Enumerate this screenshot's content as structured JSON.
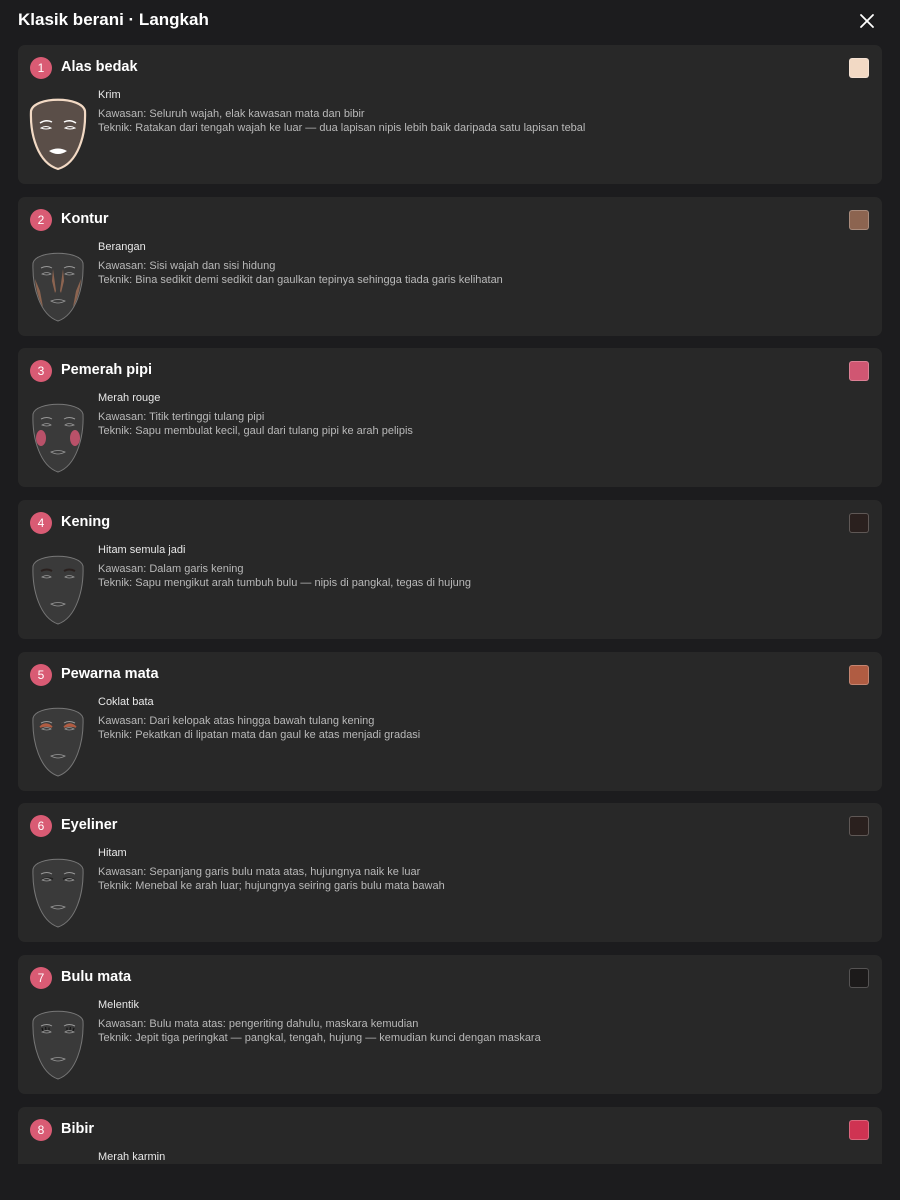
{
  "header": {
    "title": "Klasik berani · Langkah"
  },
  "steps": [
    {
      "num": "1",
      "title": "Alas bedak",
      "product": "Krim",
      "area": "Kawasan: Seluruh wajah, elak kawasan mata dan bibir",
      "technique": "Teknik: Ratakan dari tengah wajah ke luar — dua lapisan nipis lebih baik daripada satu lapisan tebal",
      "color": "#f2d9c4"
    },
    {
      "num": "2",
      "title": "Kontur",
      "product": "Berangan",
      "area": "Kawasan: Sisi wajah dan sisi hidung",
      "technique": "Teknik: Bina sedikit demi sedikit dan gaulkan tepinya sehingga tiada garis kelihatan",
      "color": "#8c6450"
    },
    {
      "num": "3",
      "title": "Pemerah pipi",
      "product": "Merah rouge",
      "area": "Kawasan: Titik tertinggi tulang pipi",
      "technique": "Teknik: Sapu membulat kecil, gaul dari tulang pipi ke arah pelipis",
      "color": "#d05672"
    },
    {
      "num": "4",
      "title": "Kening",
      "product": "Hitam semula jadi",
      "area": "Kawasan: Dalam garis kening",
      "technique": "Teknik: Sapu mengikut arah tumbuh bulu — nipis di pangkal, tegas di hujung",
      "color": "#2a201e"
    },
    {
      "num": "5",
      "title": "Pewarna mata",
      "product": "Coklat bata",
      "area": "Kawasan: Dari kelopak atas hingga bawah tulang kening",
      "technique": "Teknik: Pekatkan di lipatan mata dan gaul ke atas menjadi gradasi",
      "color": "#b05c42"
    },
    {
      "num": "6",
      "title": "Eyeliner",
      "product": "Hitam",
      "area": "Kawasan: Sepanjang garis bulu mata atas, hujungnya naik ke luar",
      "technique": "Teknik: Menebal ke arah luar; hujungnya seiring garis bulu mata bawah",
      "color": "#2a201e"
    },
    {
      "num": "7",
      "title": "Bulu mata",
      "product": "Melentik",
      "area": "Kawasan: Bulu mata atas: pengeriting dahulu, maskara kemudian",
      "technique": "Teknik: Jepit tiga peringkat — pangkal, tengah, hujung — kemudian kunci dengan maskara",
      "color": "#1c1a1a"
    },
    {
      "num": "8",
      "title": "Bibir",
      "product": "Merah karmin",
      "area": "",
      "technique": "",
      "color": "#cf3352"
    }
  ]
}
